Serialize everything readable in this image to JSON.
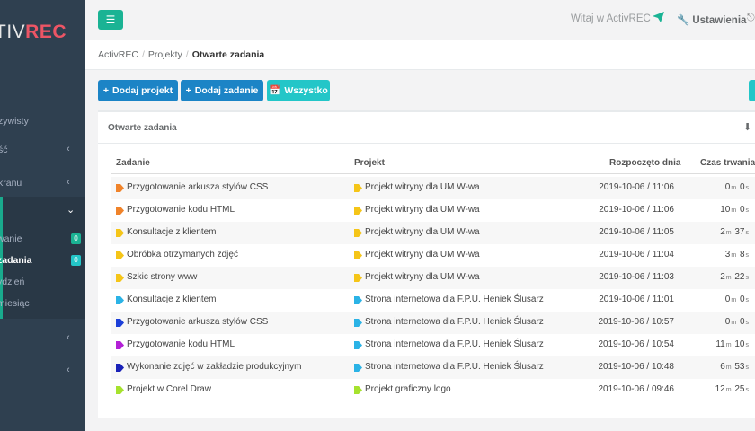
{
  "brand": {
    "part1": "TIV",
    "part2": "REC"
  },
  "sidebar": {
    "items": [
      {
        "label": "zywisty",
        "chevron": ""
      },
      {
        "label": "ść",
        "chevron": "‹"
      },
      {
        "label": "kranu",
        "chevron": "‹"
      },
      {
        "label": "",
        "chevron": "‹"
      },
      {
        "label": "",
        "chevron": "‹"
      },
      {
        "label": "",
        "chevron": "‹"
      }
    ],
    "subitems": [
      {
        "label": "wanie",
        "badge": "0"
      },
      {
        "label": "zadania",
        "badge": "0"
      },
      {
        "label": "ydzień",
        "badge": ""
      },
      {
        "label": "miesiąc",
        "badge": ""
      }
    ]
  },
  "topbar": {
    "welcome": "Witaj w ActivREC",
    "settings": "Ustawienia"
  },
  "breadcrumb": {
    "root": "ActivREC",
    "level1": "Projekty",
    "current": "Otwarte zadania"
  },
  "buttons": {
    "add_project": "Dodaj projekt",
    "add_task": "Dodaj zadanie",
    "all": "Wszystko"
  },
  "panel": {
    "title": "Otwarte zadania"
  },
  "table": {
    "headers": {
      "task": "Zadanie",
      "project": "Projekt",
      "started": "Rozpoczęto dnia",
      "duration": "Czas trwania"
    },
    "rows": [
      {
        "task": "Przygotowanie arkusza stylów CSS",
        "task_color": "#f0832a",
        "project": "Projekt witryny dla UM W-wa",
        "project_color": "#f5c518",
        "started": "2019-10-06 / 11:06",
        "d1": "0",
        "u1": "m",
        "d2": "0",
        "u2": "s"
      },
      {
        "task": "Przygotowanie kodu HTML",
        "task_color": "#f0832a",
        "project": "Projekt witryny dla UM W-wa",
        "project_color": "#f5c518",
        "started": "2019-10-06 / 11:06",
        "d1": "10",
        "u1": "m",
        "d2": "0",
        "u2": "s"
      },
      {
        "task": "Konsultacje z klientem",
        "task_color": "#f5c518",
        "project": "Projekt witryny dla UM W-wa",
        "project_color": "#f5c518",
        "started": "2019-10-06 / 11:05",
        "d1": "2",
        "u1": "m",
        "d2": "37",
        "u2": "s"
      },
      {
        "task": "Obróbka otrzymanych zdjęć",
        "task_color": "#f5c518",
        "project": "Projekt witryny dla UM W-wa",
        "project_color": "#f5c518",
        "started": "2019-10-06 / 11:04",
        "d1": "3",
        "u1": "m",
        "d2": "8",
        "u2": "s"
      },
      {
        "task": "Szkic strony www",
        "task_color": "#f5c518",
        "project": "Projekt witryny dla UM W-wa",
        "project_color": "#f5c518",
        "started": "2019-10-06 / 11:03",
        "d1": "2",
        "u1": "m",
        "d2": "22",
        "u2": "s"
      },
      {
        "task": "Konsultacje z klientem",
        "task_color": "#2bb3e6",
        "project": "Strona internetowa dla F.P.U. Heniek Ślusarz",
        "project_color": "#2bb3e6",
        "started": "2019-10-06 / 11:01",
        "d1": "0",
        "u1": "m",
        "d2": "0",
        "u2": "s"
      },
      {
        "task": "Przygotowanie arkusza stylów CSS",
        "task_color": "#1c3fd8",
        "project": "Strona internetowa dla F.P.U. Heniek Ślusarz",
        "project_color": "#2bb3e6",
        "started": "2019-10-06 / 10:57",
        "d1": "0",
        "u1": "m",
        "d2": "0",
        "u2": "s"
      },
      {
        "task": "Przygotowanie kodu HTML",
        "task_color": "#b320d6",
        "project": "Strona internetowa dla F.P.U. Heniek Ślusarz",
        "project_color": "#2bb3e6",
        "started": "2019-10-06 / 10:54",
        "d1": "11",
        "u1": "m",
        "d2": "10",
        "u2": "s"
      },
      {
        "task": "Wykonanie zdjęć w zakładzie produkcyjnym",
        "task_color": "#1a22b8",
        "project": "Strona internetowa dla F.P.U. Heniek Ślusarz",
        "project_color": "#2bb3e6",
        "started": "2019-10-06 / 10:48",
        "d1": "6",
        "u1": "m",
        "d2": "53",
        "u2": "s"
      },
      {
        "task": "Projekt w Corel Draw",
        "task_color": "#a6e22e",
        "project": "Projekt graficzny logo",
        "project_color": "#a6e22e",
        "started": "2019-10-06 / 09:46",
        "d1": "12",
        "u1": "m",
        "d2": "25",
        "u2": "s"
      }
    ]
  }
}
